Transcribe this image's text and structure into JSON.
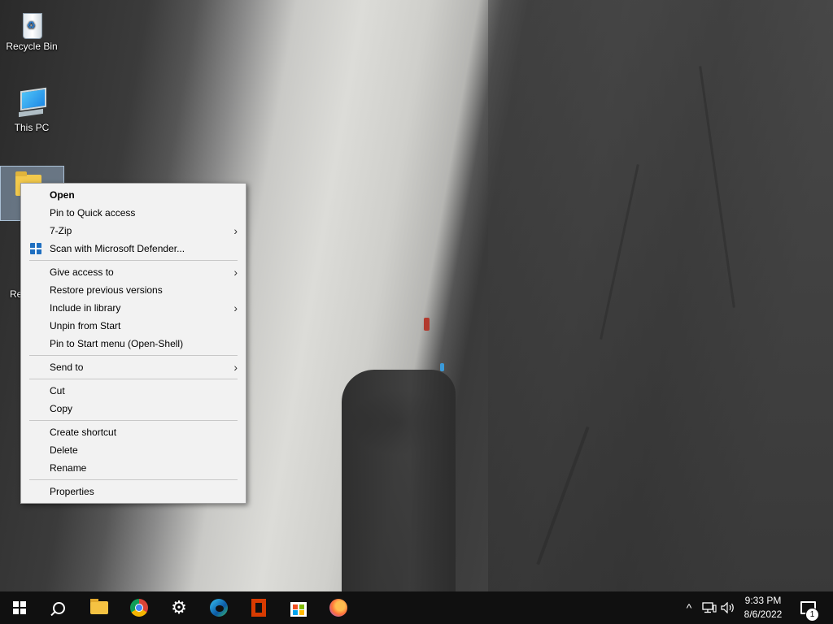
{
  "desktop": {
    "icons": [
      {
        "label": "Recycle Bin",
        "icon": "recycle-bin-icon"
      },
      {
        "label": "This PC",
        "icon": "this-pc-icon"
      },
      {
        "label": "",
        "icon": "folder-icon"
      }
    ],
    "partial_label": "Re"
  },
  "context_menu": {
    "groups": [
      [
        {
          "label": "Open",
          "bold": true
        },
        {
          "label": "Pin to Quick access"
        },
        {
          "label": "7-Zip",
          "submenu": true
        },
        {
          "label": "Scan with Microsoft Defender...",
          "icon": "defender-shield-icon"
        }
      ],
      [
        {
          "label": "Give access to",
          "submenu": true
        },
        {
          "label": "Restore previous versions"
        },
        {
          "label": "Include in library",
          "submenu": true
        },
        {
          "label": "Unpin from Start"
        },
        {
          "label": "Pin to Start menu (Open-Shell)"
        }
      ],
      [
        {
          "label": "Send to",
          "submenu": true
        }
      ],
      [
        {
          "label": "Cut"
        },
        {
          "label": "Copy"
        }
      ],
      [
        {
          "label": "Create shortcut"
        },
        {
          "label": "Delete"
        },
        {
          "label": "Rename"
        }
      ],
      [
        {
          "label": "Properties"
        }
      ]
    ],
    "submenu_arrow": "›"
  },
  "taskbar": {
    "buttons": [
      {
        "name": "start-button",
        "icon": "windows-logo-icon"
      },
      {
        "name": "search-button",
        "icon": "search-icon"
      },
      {
        "name": "file-explorer-button",
        "icon": "file-explorer-icon"
      },
      {
        "name": "chrome-button",
        "icon": "chrome-icon"
      },
      {
        "name": "settings-button",
        "icon": "gear-icon"
      },
      {
        "name": "edge-button",
        "icon": "edge-icon"
      },
      {
        "name": "office-button",
        "icon": "office-icon"
      },
      {
        "name": "store-button",
        "icon": "microsoft-store-icon"
      },
      {
        "name": "firefox-button",
        "icon": "firefox-icon"
      }
    ],
    "tray": {
      "chevron": "^",
      "network_icon": "network-icon",
      "volume_icon": "volume-icon"
    },
    "clock": {
      "time": "9:33 PM",
      "date": "8/6/2022"
    },
    "notifications": {
      "icon": "action-center-icon",
      "count": "1"
    }
  },
  "colors": {
    "taskbar_bg": "#101010",
    "menu_bg": "#f2f2f2",
    "accent": "#1f6fc0"
  }
}
